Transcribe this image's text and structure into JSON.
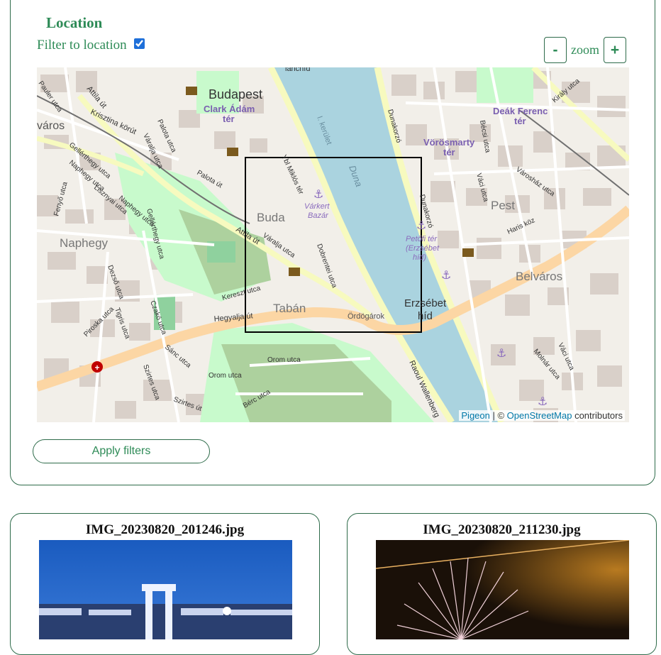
{
  "location": {
    "title": "Location",
    "filter_label": "Filter to location",
    "filter_checked": true,
    "zoom_out": "-",
    "zoom_label": "zoom",
    "zoom_in": "+"
  },
  "map": {
    "labels": {
      "budapest": "Budapest",
      "clark1": "Clark Ádám",
      "clark2": "tér",
      "varos": "város",
      "buda": "Buda",
      "naphegy": "Naphegy",
      "taban": "Tabán",
      "pest": "Pest",
      "belvaros": "Belváros",
      "deak1": "Deák Ferenc",
      "deak2": "tér",
      "voros1": "Vörösmarty",
      "voros2": "tér",
      "erzsebet1": "Erzsébet",
      "erzsebet2": "híd",
      "duna": "Duna",
      "kerulet": "I. kerület",
      "varkert1": "Várkert",
      "varkert2": "Bazár",
      "petofi1": "Petőfi tér",
      "petofi2": "(Erzsébet",
      "petofi3": "híd)",
      "ordogarok": "Ördögárok",
      "hegyalja": "Hegyalja út",
      "attila1": "Attila út",
      "attila2": "Attila út",
      "krisztina": "Krisztina körút",
      "gellerthegy1": "Gellérthegy utca",
      "gellerthegy2": "Gellérthegy utca",
      "naphegy_utca": "Naphegy utca",
      "lisznyai": "Lisznyai utca",
      "palota1": "Palota út",
      "palota2": "Palota utca",
      "varalja1": "Váralja utca",
      "varalja2": "Váralja utca",
      "ybl": "Ybl Miklós tér",
      "dobrentei": "Dobrentei utca",
      "keresz": "Kereszt utca",
      "orom": "Orom utca",
      "berc": "Bérc utca",
      "sanc": "Sánc utca",
      "szirtes1": "Szirtes út",
      "szirtes2": "Szirtes utca",
      "raoul": "Raoul Wallenberg",
      "dunakorzo1": "Dunakorzó",
      "dunakorzo2": "Dunakorzó",
      "becsi": "Bécsi utca",
      "vaci1": "Váci utca",
      "vaci2": "Váci utca",
      "varoshaz": "Városház utca",
      "haris": "Haris köz",
      "molnar": "Molnár utca",
      "kiraly": "Király utca",
      "pauler": "Pauler utca",
      "fenyo": "Fenyő utca",
      "dezso": "Dezső utca",
      "tigris": "Tigris utca",
      "pipiske": "Piroska utca",
      "crano": "Czakó utca",
      "orom2": "Orom utca",
      "hanchid": "lánchíd"
    },
    "attribution_link1": "Pigeon",
    "attribution_sep": " | © ",
    "attribution_link2": "OpenStreetMap",
    "attribution_tail": " contributors"
  },
  "apply_label": "Apply filters",
  "photos": [
    {
      "filename": "IMG_20230820_201246.jpg"
    },
    {
      "filename": "IMG_20230820_211230.jpg"
    }
  ],
  "colors": {
    "accent": "#2e8b57",
    "border": "#2e6b4a",
    "water": "#aad3df",
    "park": "#c8facc",
    "road_major": "#fcd6a4",
    "building": "#d9d0c9"
  }
}
